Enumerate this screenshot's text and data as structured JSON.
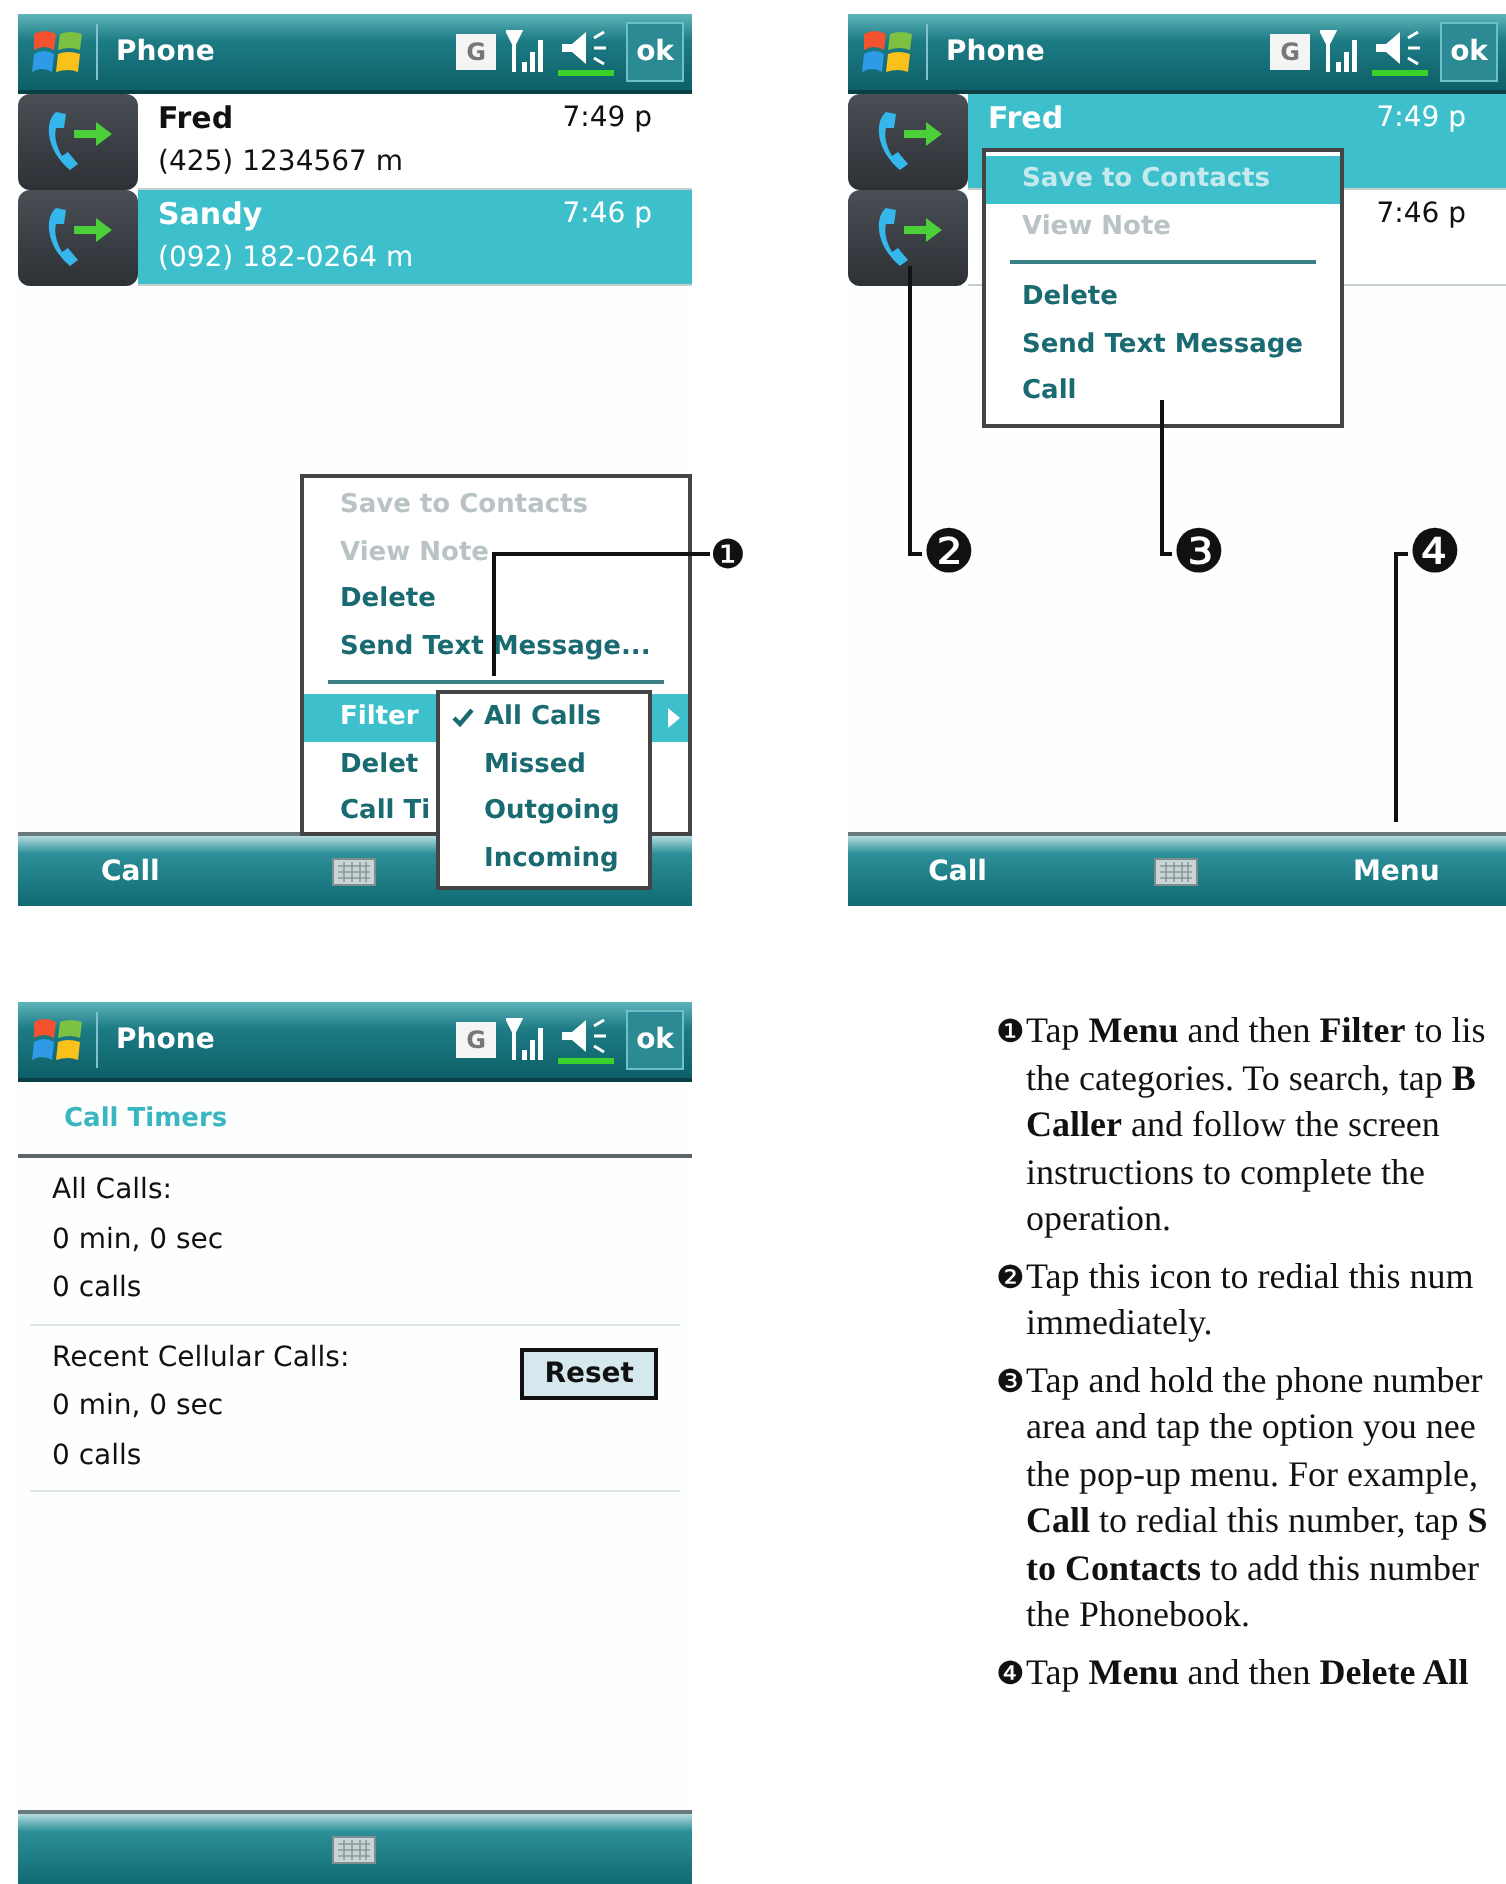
{
  "screens": [
    {
      "title": "Phone",
      "network": "G",
      "ok": "ok",
      "calls": [
        {
          "name": "Fred",
          "number": "(425) 1234567 m",
          "time": "7:49 p",
          "selected": false
        },
        {
          "name": "Sandy",
          "number": "(092) 182-0264 m",
          "time": "7:46 p",
          "selected": true
        }
      ],
      "menu": {
        "items": [
          {
            "kind": "item",
            "label": "Save to Contacts",
            "disabled": true,
            "selected": false
          },
          {
            "kind": "item",
            "label": "View Note",
            "disabled": true,
            "selected": false
          },
          {
            "kind": "item",
            "label": "Delete",
            "disabled": false,
            "selected": false
          },
          {
            "kind": "item",
            "label": "Send Text Message...",
            "disabled": false,
            "selected": false
          },
          {
            "kind": "separator"
          },
          {
            "kind": "submenu",
            "label": "Filter",
            "disabled": false,
            "selected": true
          },
          {
            "kind": "item",
            "label": "Delet",
            "disabled": false,
            "selected": false
          },
          {
            "kind": "item",
            "label": "Call Ti",
            "disabled": false,
            "selected": false
          }
        ],
        "submenu": [
          {
            "label": "All Calls",
            "checked": true
          },
          {
            "label": "Missed",
            "checked": false
          },
          {
            "label": "Outgoing",
            "checked": false
          },
          {
            "label": "Incoming",
            "checked": false
          }
        ]
      },
      "softkeys": {
        "left": "Call"
      },
      "callouts": [
        "❶"
      ]
    },
    {
      "title": "Phone",
      "network": "G",
      "ok": "ok",
      "calls": [
        {
          "name": "Fred",
          "time": "7:49 p",
          "selected": true
        },
        {
          "time": "7:46 p",
          "selected": false
        }
      ],
      "menu": {
        "items": [
          {
            "kind": "item",
            "label": "Save to Contacts",
            "disabled": true,
            "selected": true
          },
          {
            "kind": "item",
            "label": "View Note",
            "disabled": true,
            "selected": false
          },
          {
            "kind": "separator"
          },
          {
            "kind": "item",
            "label": "Delete",
            "disabled": false,
            "selected": false
          },
          {
            "kind": "item",
            "label": "Send Text Message",
            "disabled": false,
            "selected": false
          },
          {
            "kind": "item",
            "label": "Call",
            "disabled": false,
            "selected": false
          }
        ]
      },
      "softkeys": {
        "left": "Call",
        "right": "Menu"
      },
      "callouts": [
        "❷",
        "❸",
        "❹"
      ]
    },
    {
      "title": "Phone",
      "network": "G",
      "ok": "ok",
      "timers": {
        "heading": "Call Timers",
        "sections": [
          {
            "label": "All Calls:",
            "duration": "0 min, 0 sec",
            "count": "0 calls"
          },
          {
            "label": "Recent Cellular Calls:",
            "duration": "0 min, 0 sec",
            "count": "0 calls",
            "button": "Reset"
          }
        ]
      }
    }
  ],
  "notes": [
    {
      "marker": "❶",
      "lines": [
        "Tap **Menu** and then **Filter** to lis",
        "the categories. To search, tap **B**",
        "**Caller** and follow the screen",
        "instructions to complete the",
        "operation."
      ]
    },
    {
      "marker": "❷",
      "lines": [
        "Tap this icon to redial this num",
        "immediately."
      ]
    },
    {
      "marker": "❸",
      "lines": [
        "Tap and hold the phone number",
        "area and tap the option you nee",
        "the pop-up menu. For example,",
        "**Call** to redial this number, tap **S**",
        "**to Contacts** to add this number",
        "the Phonebook."
      ]
    },
    {
      "marker": "❹",
      "lines": [
        "Tap **Menu** and then **Delete All**"
      ]
    }
  ]
}
